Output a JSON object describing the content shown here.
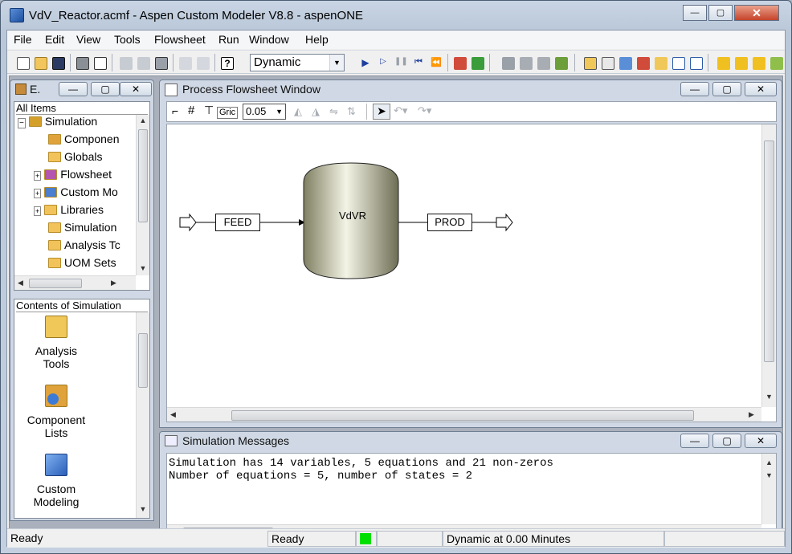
{
  "window": {
    "title": "VdV_Reactor.acmf - Aspen Custom Modeler V8.8 - aspenONE",
    "minimize": "—",
    "maximize": "▢",
    "close": "✕"
  },
  "menu": [
    "File",
    "Edit",
    "View",
    "Tools",
    "Flowsheet",
    "Run",
    "Window",
    "Help"
  ],
  "toolbar": {
    "run_mode": "Dynamic"
  },
  "explorer": {
    "title": "E.",
    "all_items": "All Items",
    "tree": [
      "Simulation",
      "Componen",
      "Globals",
      "Flowsheet",
      "Custom Mo",
      "Libraries",
      "Simulation",
      "Analysis Tc",
      "UOM Sets"
    ],
    "contents_label": "Contents of Simulation",
    "contents": [
      {
        "line1": "Analysis",
        "line2": "Tools"
      },
      {
        "line1": "Component",
        "line2": "Lists"
      },
      {
        "line1": "Custom",
        "line2": "Modeling"
      }
    ]
  },
  "flowsheet": {
    "title": "Process Flowsheet Window",
    "grid_label": "Gric",
    "grid_value": "0.05",
    "reactor": "VdVR",
    "feed": "FEED",
    "prod": "PROD"
  },
  "messages": {
    "title": "Simulation Messages",
    "lines": [
      "Simulation has 14 variables, 5 equations and 21 non-zeros",
      "Number of equations = 5, number of states = 2"
    ]
  },
  "status": {
    "left": "Ready",
    "middle": "Ready",
    "time": "Dynamic at 0.00 Minutes"
  },
  "colors": {
    "run_indicator": "#00e000",
    "accent": "#1d4f9e"
  }
}
